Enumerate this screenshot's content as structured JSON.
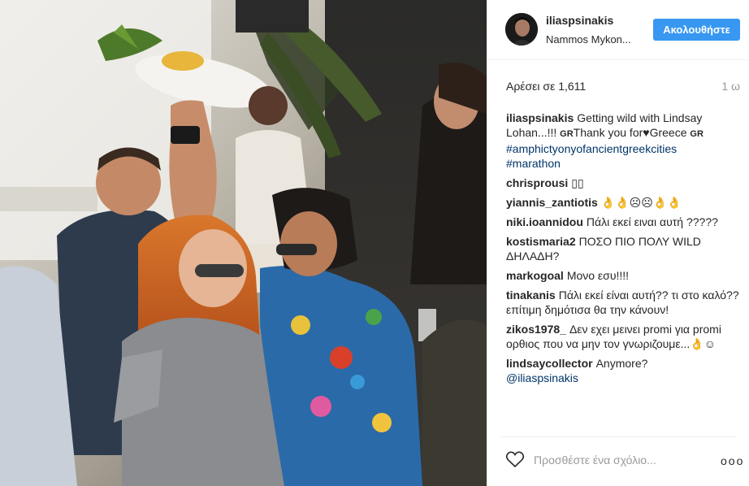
{
  "post": {
    "username": "iliaspsinakis",
    "location": "Nammos Mykon...",
    "follow_label": "Ακολουθήστε",
    "likes_prefix": "Αρέσει σε",
    "likes_count": "1,611",
    "time_ago": "1 ω"
  },
  "caption": {
    "user": "iliaspsinakis",
    "text_a": "Getting wild with Lindsay Lohan...!!!",
    "flag_1": "GR",
    "text_b": "Thank you for",
    "heart": "♥",
    "text_c": "Greece",
    "flag_2": "GR",
    "hashtag_1": "#amphictyonyofancientgreekcities",
    "hashtag_2": "#marathon"
  },
  "comments": [
    {
      "user": "chrisprousi",
      "text": "▯▯"
    },
    {
      "user": "yiannis_zantiotis",
      "text": "👌👌☹☹👌👌"
    },
    {
      "user": "niki.ioannidou",
      "text": "Πάλι εκεί ειναι αυτή ?????"
    },
    {
      "user": "kostismaria2",
      "text": "ΠΟΣΟ ΠΙΟ ΠΟΛΥ WILD ΔΗΛΑΔΗ?"
    },
    {
      "user": "markogoal",
      "text": "Μονο εσυ!!!!"
    },
    {
      "user": "tinakanis",
      "text": "Πάλι εκεί είναι αυτή?? τι στο καλό?? επίτιμη δημότισα θα την κάνουν!"
    },
    {
      "user": "zikos1978_",
      "text": "Δεν εχει μεινει promi για promi ορθιος που να μην τον γνωριζουμε...👌☺"
    },
    {
      "user": "lindsaycollector",
      "text": "Anymore?",
      "mention": "@iliaspsinakis"
    }
  ],
  "footer": {
    "comment_placeholder": "Προσθέστε ένα σχόλιο...",
    "more_label": "ooo"
  },
  "icons": {
    "heart": "heart-icon",
    "more": "more-options-icon"
  },
  "colors": {
    "accent": "#3897f0",
    "hashtag": "#003569",
    "muted": "#999999",
    "text": "#262626"
  }
}
